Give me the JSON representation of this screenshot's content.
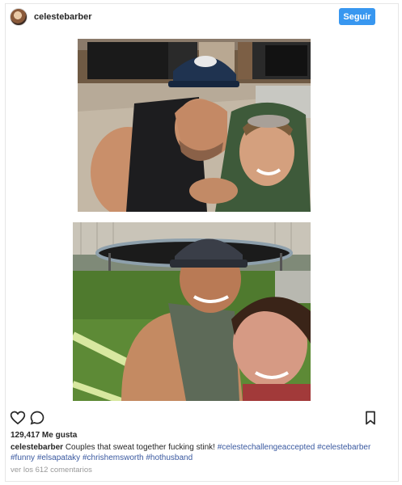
{
  "post": {
    "username": "celestebarber",
    "follow_label": "Seguir",
    "likes_text": "129,417 Me gusta",
    "caption_user": "celestebarber",
    "caption_text": " Couples that sweat together fucking stink! ",
    "hashtags": [
      "#celestechallengeaccepted",
      "#celestebarber",
      "#funny",
      "#elsapataky",
      "#chrishemsworth",
      "#hothusband"
    ],
    "view_comments": "ver los 612 comentarios"
  },
  "photos": {
    "top": {
      "cap_logo": ""
    },
    "bottom": {}
  },
  "colors": {
    "follow_button": "#3897f0",
    "hashtag": "#3a59a0",
    "muted": "#999999"
  },
  "icons": [
    "heart-icon",
    "comment-icon",
    "bookmark-icon"
  ]
}
